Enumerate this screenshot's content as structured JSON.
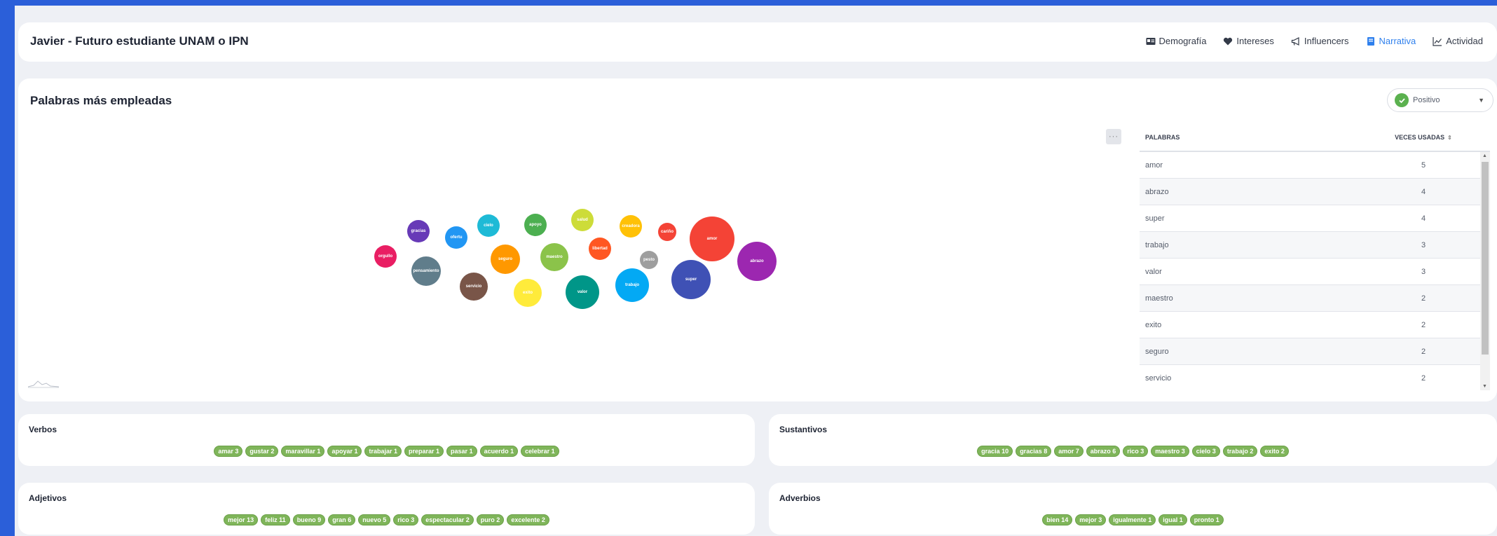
{
  "header": {
    "title": "Javier - Futuro estudiante UNAM o IPN",
    "nav": [
      {
        "label": "Demografía",
        "icon": "id-card-icon"
      },
      {
        "label": "Intereses",
        "icon": "heart-icon"
      },
      {
        "label": "Influencers",
        "icon": "megaphone-icon"
      },
      {
        "label": "Narrativa",
        "icon": "book-icon",
        "active": true
      },
      {
        "label": "Actividad",
        "icon": "line-chart-icon"
      }
    ]
  },
  "words_card": {
    "title": "Palabras más empleadas",
    "sentiment": "Positivo",
    "menu_label": "···"
  },
  "bubbles": [
    {
      "label": "orgullo",
      "color": "#e91e63"
    },
    {
      "label": "gracias",
      "color": "#673ab7"
    },
    {
      "label": "pensamiento",
      "color": "#607d8b"
    },
    {
      "label": "ofertu",
      "color": "#2196f3"
    },
    {
      "label": "cielo",
      "color": "#1ebad6"
    },
    {
      "label": "servicio",
      "color": "#795548"
    },
    {
      "label": "seguro",
      "color": "#ff9800"
    },
    {
      "label": "apoyo",
      "color": "#4caf50"
    },
    {
      "label": "exito",
      "color": "#ffeb3b"
    },
    {
      "label": "maestro",
      "color": "#8bc34a"
    },
    {
      "label": "salud",
      "color": "#cddc39"
    },
    {
      "label": "valor",
      "color": "#009688"
    },
    {
      "label": "libertad",
      "color": "#ff5722"
    },
    {
      "label": "creadora",
      "color": "#ffc107"
    },
    {
      "label": "trabajo",
      "color": "#03a9f4"
    },
    {
      "label": "pesto",
      "color": "#9e9e9e"
    },
    {
      "label": "cariño",
      "color": "#f44336"
    },
    {
      "label": "super",
      "color": "#3f51b5"
    },
    {
      "label": "amor",
      "color": "#f44336"
    },
    {
      "label": "abrazo",
      "color": "#9c27b0"
    }
  ],
  "table": {
    "col_word": "PALABRAS",
    "col_count": "VECES USADAS",
    "rows": [
      {
        "word": "amor",
        "count": "5"
      },
      {
        "word": "abrazo",
        "count": "4"
      },
      {
        "word": "super",
        "count": "4"
      },
      {
        "word": "trabajo",
        "count": "3"
      },
      {
        "word": "valor",
        "count": "3"
      },
      {
        "word": "maestro",
        "count": "2"
      },
      {
        "word": "exito",
        "count": "2"
      },
      {
        "word": "seguro",
        "count": "2"
      },
      {
        "word": "servicio",
        "count": "2"
      }
    ]
  },
  "pos": {
    "verbos": {
      "title": "Verbos",
      "items": [
        "amar 3",
        "gustar 2",
        "maravillar 1",
        "apoyar 1",
        "trabajar 1",
        "preparar 1",
        "pasar 1",
        "acuerdo 1",
        "celebrar 1"
      ]
    },
    "sustantivos": {
      "title": "Sustantivos",
      "items": [
        "gracia 10",
        "gracias 8",
        "amor 7",
        "abrazo 6",
        "rico 3",
        "maestro 3",
        "cielo 3",
        "trabajo 2",
        "exito 2"
      ]
    },
    "adjetivos": {
      "title": "Adjetivos",
      "items": [
        "mejor 13",
        "feliz 11",
        "bueno 9",
        "gran 6",
        "nuevo 5",
        "rico 3",
        "espectacular 2",
        "puro 2",
        "excelente 2"
      ]
    },
    "adverbios": {
      "title": "Adverbios",
      "items": [
        "bien 14",
        "mejor 3",
        "igualmente 1",
        "igual 1",
        "pronto 1"
      ]
    }
  }
}
